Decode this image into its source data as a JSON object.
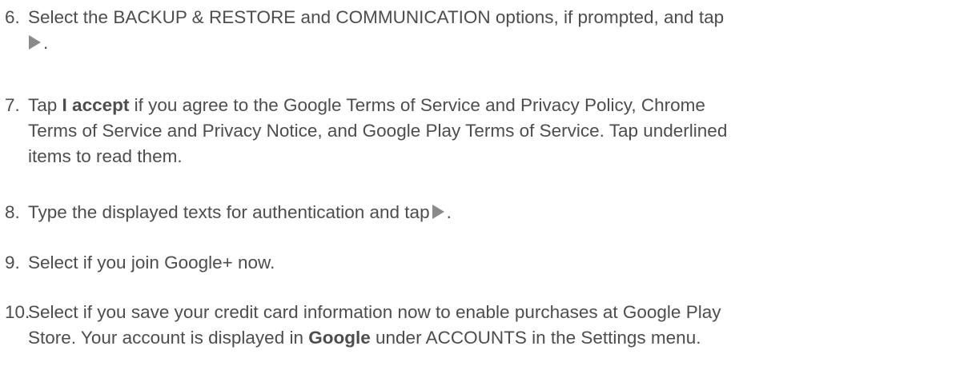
{
  "steps": [
    {
      "number": "6.",
      "line1": "Select the BACKUP & RESTORE and COMMUNICATION options, if prompted, and tap",
      "line2_after_icon": ".",
      "icon": "play-arrow-icon"
    },
    {
      "number": "7.",
      "tap": "Tap",
      "bold": "I accept",
      "line1_rest": "if you agree to the Google Terms of Service and Privacy Policy, Chrome",
      "line2": "Terms of Service and Privacy Notice, and Google Play Terms of Service. Tap underlined",
      "line3": "items to read them."
    },
    {
      "number": "8.",
      "text": "Type the displayed texts for authentication and tap",
      "after_icon": ".",
      "icon": "play-arrow-icon"
    },
    {
      "number": "9.",
      "text": "Select if you join Google+ now."
    },
    {
      "number": "10.",
      "line1": "Select if you save your credit card information now to enable purchases at Google Play",
      "line2_before": "Store. Your account is displayed in",
      "bold": "Google",
      "line2_after": "under ACCOUNTS in the Settings menu."
    }
  ],
  "colors": {
    "text": "#4d4d4d",
    "icon": "#8a8a8a"
  }
}
